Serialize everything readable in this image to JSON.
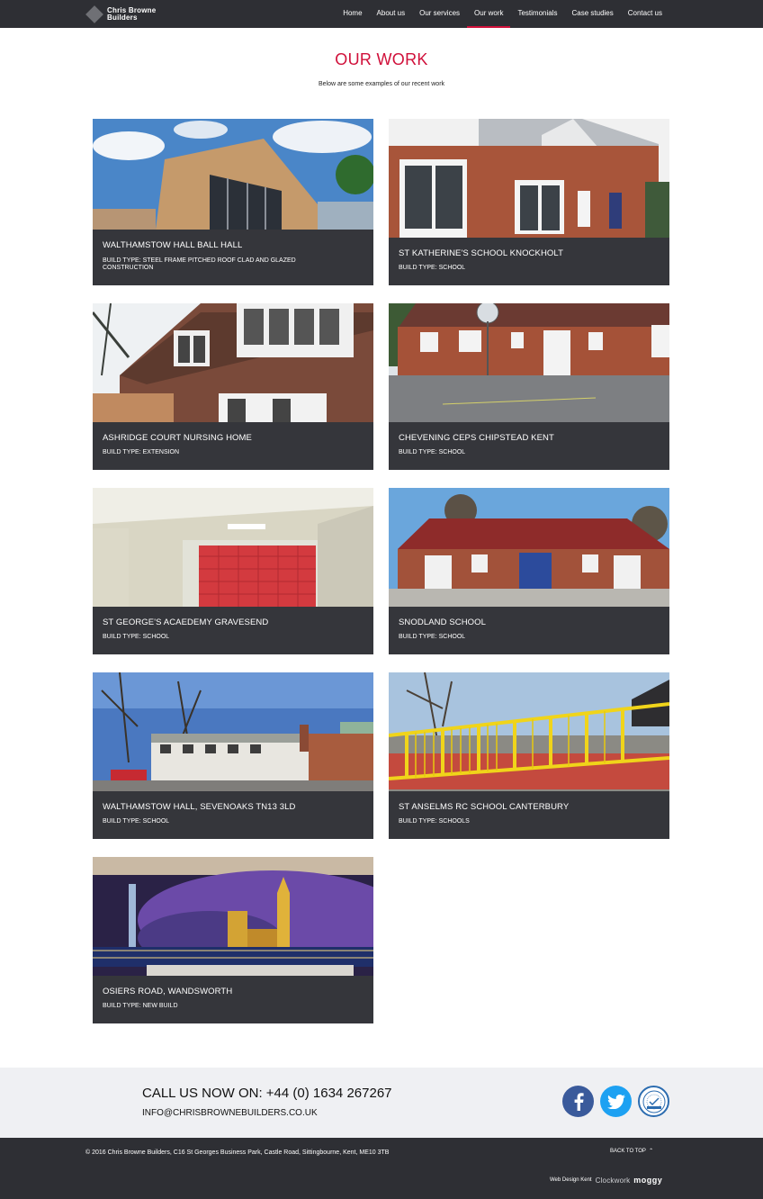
{
  "header": {
    "logo_line1": "Chris Browne",
    "logo_line2": "Builders",
    "nav": [
      "Home",
      "About us",
      "Our services",
      "Our work",
      "Testimonials",
      "Case studies",
      "Contact us"
    ],
    "active_nav": "Our work"
  },
  "page": {
    "title": "OUR WORK",
    "subtitle": "Below are some examples of our recent work"
  },
  "projects": [
    {
      "title": "WALTHAMSTOW HALL BALL HALL",
      "build_type": "BUILD TYPE: STEEL FRAME PITCHED ROOF CLAD AND GLAZED CONSTRUCTION"
    },
    {
      "title": "ST KATHERINE'S SCHOOL KNOCKHOLT",
      "build_type": "BUILD TYPE: SCHOOL"
    },
    {
      "title": "ASHRIDGE COURT NURSING HOME",
      "build_type": "BUILD TYPE: EXTENSION"
    },
    {
      "title": "CHEVENING CEPS CHIPSTEAD KENT",
      "build_type": "BUILD TYPE: SCHOOL"
    },
    {
      "title": "ST GEORGE'S ACAEDEMY GRAVESEND",
      "build_type": "BUILD TYPE: SCHOOL"
    },
    {
      "title": "SNODLAND SCHOOL",
      "build_type": "BUILD TYPE: SCHOOL"
    },
    {
      "title": "WALTHAMSTOW HALL, SEVENOAKS TN13 3LD",
      "build_type": "BUILD TYPE: SCHOOL"
    },
    {
      "title": "ST ANSELMS RC SCHOOL CANTERBURY",
      "build_type": "BUILD TYPE: SCHOOLS"
    },
    {
      "title": "OSIERS ROAD, WANDSWORTH",
      "build_type": "BUILD TYPE: NEW BUILD"
    }
  ],
  "contact": {
    "call": "CALL US NOW ON: +44 (0) 1634 267267",
    "email": "INFO@CHRISBROWNEBUILDERS.CO.UK"
  },
  "social": [
    {
      "icon": "facebook-icon",
      "color": "#3a5a9b"
    },
    {
      "icon": "twitter-icon",
      "color": "#1da1f2"
    },
    {
      "icon": "approved-badge-icon",
      "color": "#2b6cb0"
    }
  ],
  "footer": {
    "copyright": "© 2016 Chris Browne Builders, C16 St Georges Business Park, Castle Road, Sittingbourne, Kent, ME10 3TB",
    "back_to_top": "BACK TO TOP",
    "credit_label": "Web Design Kent",
    "credit_brand_1": "Clockwork",
    "credit_brand_2": "moggy"
  },
  "colors": {
    "accent": "#d0103a",
    "dark": "#2e2f34",
    "card": "#35363b",
    "band": "#eff0f3"
  }
}
